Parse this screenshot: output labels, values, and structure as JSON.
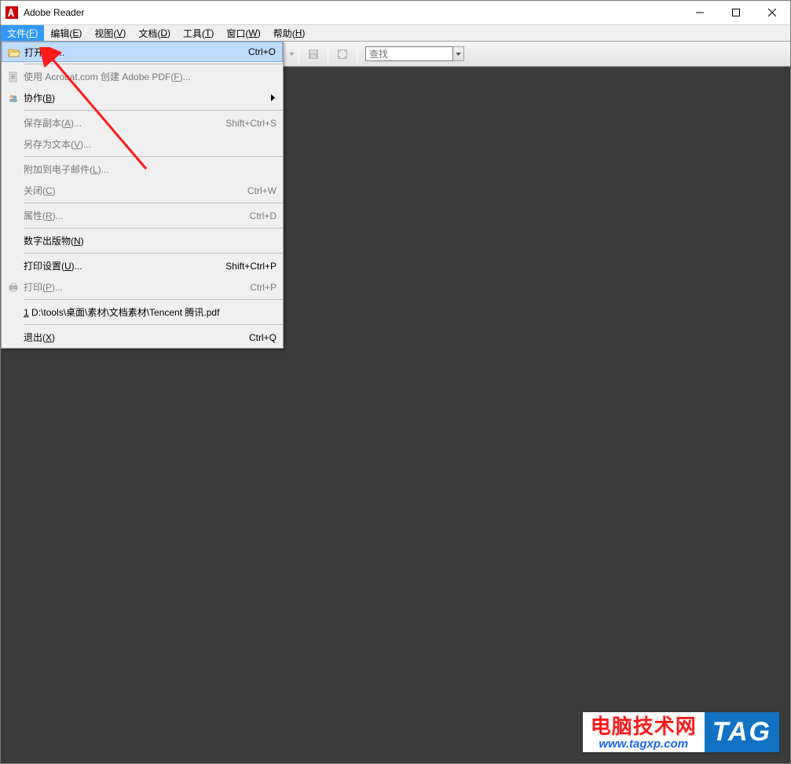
{
  "title": "Adobe Reader",
  "menubar": [
    {
      "label_pre": "文件(",
      "key": "F",
      "label_post": ")"
    },
    {
      "label_pre": "编辑(",
      "key": "E",
      "label_post": ")"
    },
    {
      "label_pre": "视图(",
      "key": "V",
      "label_post": ")"
    },
    {
      "label_pre": "文档(",
      "key": "D",
      "label_post": ")"
    },
    {
      "label_pre": "工具(",
      "key": "T",
      "label_post": ")"
    },
    {
      "label_pre": "窗口(",
      "key": "W",
      "label_post": ")"
    },
    {
      "label_pre": "帮助(",
      "key": "H",
      "label_post": ")"
    }
  ],
  "toolbar": {
    "find_placeholder": "查找"
  },
  "file_menu": {
    "open": {
      "pre": "打开(",
      "key": "O",
      "post": ")...",
      "shortcut": "Ctrl+O"
    },
    "create_pdf": {
      "pre": "使用 Acrobat.com 创建 Adobe PDF(",
      "key": "F",
      "post": ")..."
    },
    "collab": {
      "pre": "协作(",
      "key": "B",
      "post": ")"
    },
    "save_copy": {
      "pre": "保存副本(",
      "key": "A",
      "post": ")...",
      "shortcut": "Shift+Ctrl+S"
    },
    "save_text": {
      "pre": "另存为文本(",
      "key": "V",
      "post": ")..."
    },
    "attach": {
      "pre": "附加到电子邮件(",
      "key": "L",
      "post": ")..."
    },
    "close": {
      "pre": "关闭(",
      "key": "C",
      "post": ")",
      "shortcut": "Ctrl+W"
    },
    "props": {
      "pre": "属性(",
      "key": "R",
      "post": ")...",
      "shortcut": "Ctrl+D"
    },
    "digital": {
      "pre": "数字出版物(",
      "key": "N",
      "post": ")"
    },
    "print_setup": {
      "pre": "打印设置(",
      "key": "U",
      "post": ")...",
      "shortcut": "Shift+Ctrl+P"
    },
    "print": {
      "pre": "打印(",
      "key": "P",
      "post": ")...",
      "shortcut": "Ctrl+P"
    },
    "recent1": {
      "num": "1",
      "path": " D:\\tools\\桌面\\素材\\文档素材\\Tencent 腾讯.pdf"
    },
    "exit": {
      "pre": "退出(",
      "key": "X",
      "post": ")",
      "shortcut": "Ctrl+Q"
    }
  },
  "watermark": {
    "cn": "电脑技术网",
    "url": "www.tagxp.com",
    "tag": "TAG"
  }
}
